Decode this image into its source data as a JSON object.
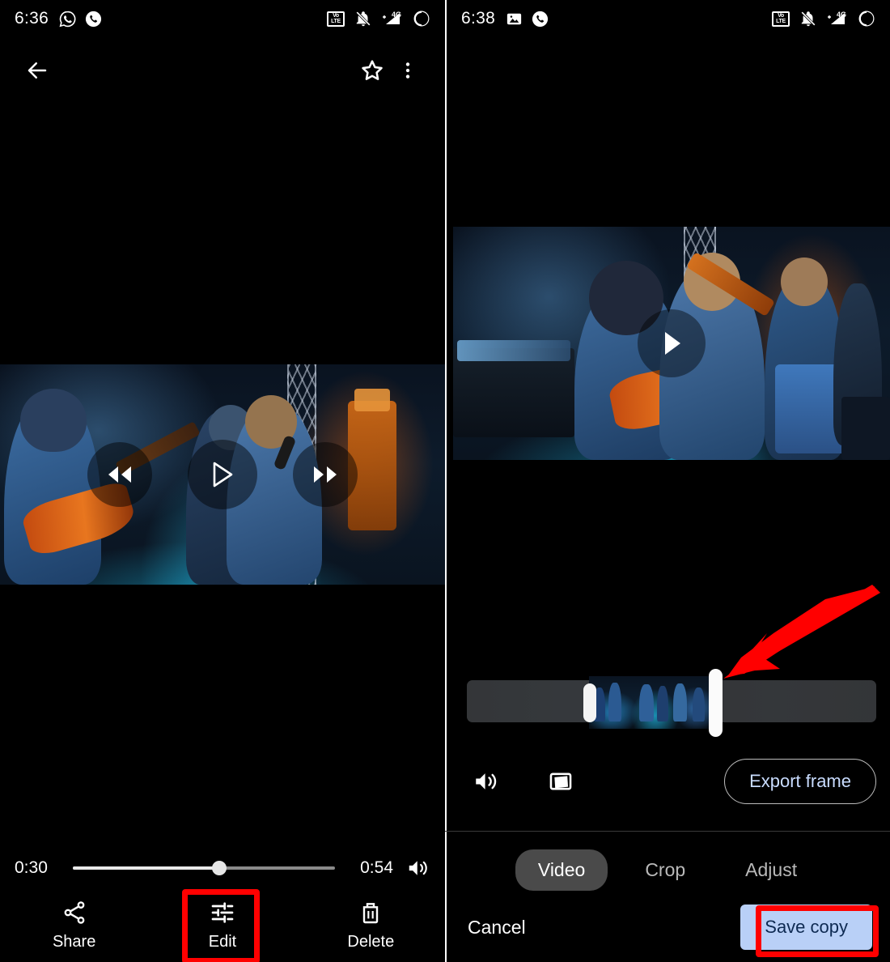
{
  "left_panel": {
    "statusbar": {
      "time": "6:36",
      "left_icons": [
        "whatsapp-icon",
        "phone-icon"
      ],
      "right_icons": [
        "volte-icon",
        "notifications-off-icon",
        "signal-4g-icon",
        "battery-icon"
      ],
      "volte_top": "Vo",
      "volte_bottom": "LTE",
      "network_label": "4G"
    },
    "appbar": {
      "back": "back-arrow-icon",
      "favorite": "star-outline-icon",
      "overflow": "more-vert-icon"
    },
    "player": {
      "rewind": "rewind-10-icon",
      "play": "play-icon",
      "forward": "forward-10-icon",
      "current_time": "0:30",
      "total_time": "0:54",
      "progress_percent": 56,
      "volume": "volume-up-icon"
    },
    "actions": [
      {
        "label": "Share",
        "icon": "share-icon",
        "highlighted": false
      },
      {
        "label": "Edit",
        "icon": "tune-icon",
        "highlighted": true
      },
      {
        "label": "Delete",
        "icon": "trash-icon",
        "highlighted": false
      }
    ]
  },
  "right_panel": {
    "statusbar": {
      "time": "6:38",
      "left_icons": [
        "photo-icon",
        "phone-icon"
      ],
      "right_icons": [
        "volte-icon",
        "notifications-off-icon",
        "signal-4g-icon",
        "battery-icon"
      ],
      "volte_top": "Vo",
      "volte_bottom": "LTE",
      "network_label": "4G"
    },
    "preview": {
      "play": "play-icon"
    },
    "trim": {
      "selection_start_percent": 30,
      "selection_end_percent": 61,
      "left_handle": "trim-handle-left",
      "right_handle": "trim-handle-right"
    },
    "tools": [
      {
        "label": "",
        "icon": "volume-up-icon"
      },
      {
        "label": "",
        "icon": "stabilize-icon"
      }
    ],
    "export_button": "Export frame",
    "tabs": [
      {
        "label": "Video",
        "active": true
      },
      {
        "label": "Crop",
        "active": false
      },
      {
        "label": "Adjust",
        "active": false
      }
    ],
    "cancel_label": "Cancel",
    "save_label": "Save copy"
  },
  "annotations": {
    "arrow_color": "#ff0000",
    "highlight_color": "#ff0000",
    "edit_highlight_target": "Edit",
    "save_highlight_target": "Save copy",
    "arrow_points_to": "trim-handle-right"
  },
  "colors": {
    "background": "#000000",
    "accent_blue": "#b9d0f7",
    "accent_text": "#0e2a52",
    "tab_active_bg": "#4a4a4a",
    "highlight_red": "#ff0000"
  }
}
